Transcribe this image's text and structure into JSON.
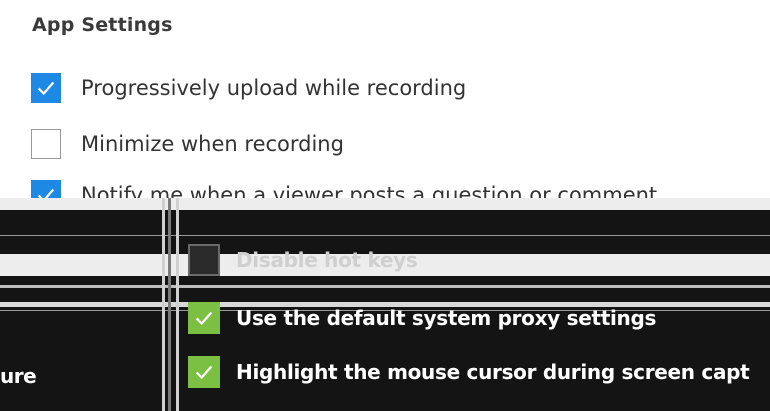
{
  "section_title": "App Settings",
  "options": [
    {
      "label": "Progressively upload while recording",
      "checked": true
    },
    {
      "label": "Minimize when recording",
      "checked": false
    },
    {
      "label": "Notify me when a viewer posts a question or comment",
      "checked": true
    }
  ],
  "overlay_options": [
    {
      "label": "Disable hot keys",
      "checked": false
    },
    {
      "label": "Use the default system proxy settings",
      "checked": true
    },
    {
      "label": "Highlight the mouse cursor during screen capt",
      "checked": true
    }
  ],
  "overlay_fragment": "ure",
  "colors": {
    "checked_blue": "#1e88e5",
    "checked_green": "#7bc043",
    "dark_bg": "#141414"
  }
}
